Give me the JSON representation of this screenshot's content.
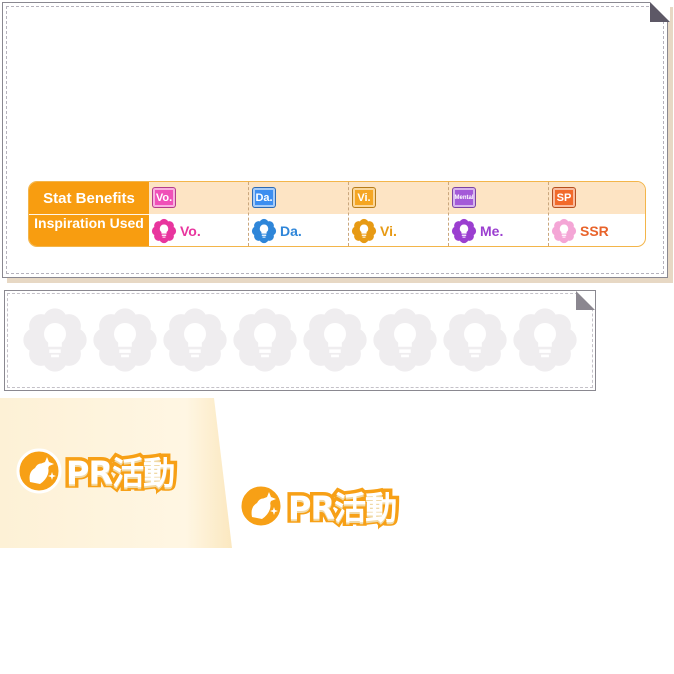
{
  "stat_table": {
    "header_stat": "Stat Benefits",
    "header_inspiration": "Inspiration Used",
    "badges": [
      {
        "label": "Vo.",
        "color": "#f050b8"
      },
      {
        "label": "Da.",
        "color": "#3d8ef0"
      },
      {
        "label": "Vi.",
        "color": "#f5a623"
      },
      {
        "label": "Mental",
        "color": "#a45ad8"
      },
      {
        "label": "SP",
        "color": "#f26a2a"
      }
    ],
    "inspirations": [
      {
        "label": "Vo.",
        "color": "#e8359e",
        "icon": "vocal-inspiration-icon"
      },
      {
        "label": "Da.",
        "color": "#2f86d9",
        "icon": "dance-inspiration-icon"
      },
      {
        "label": "Vi.",
        "color": "#e79a14",
        "icon": "visual-inspiration-icon"
      },
      {
        "label": "Me.",
        "color": "#9b3fd0",
        "icon": "mental-inspiration-icon"
      },
      {
        "label": "SSR",
        "color": "#e8632b",
        "icon": "ssr-inspiration-icon"
      }
    ]
  },
  "inspiration_slots": {
    "count": 8,
    "icon": "empty-inspiration-slot-icon",
    "color": "#efedef"
  },
  "pr_activity": {
    "label": "PR活動",
    "icon": "pr-sparkle-icon",
    "accent": "#f7a016"
  }
}
